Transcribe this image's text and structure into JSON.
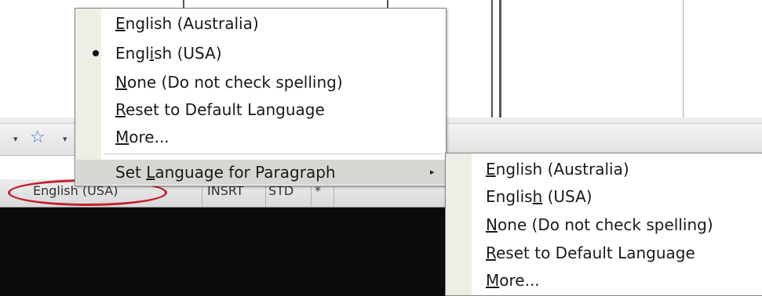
{
  "status_bar": {
    "language": "English (USA)",
    "insert_mode": "INSRT",
    "selection_mode": "STD",
    "modified": "*"
  },
  "language_menu": {
    "items": [
      {
        "label_pre": "",
        "mnemonic": "E",
        "label_post": "nglish (Australia)",
        "checked": false
      },
      {
        "label_pre": "Engl",
        "mnemonic": "i",
        "label_post": "sh (USA)",
        "checked": true
      },
      {
        "label_pre": "",
        "mnemonic": "N",
        "label_post": "one (Do not check spelling)",
        "checked": false
      },
      {
        "label_pre": "",
        "mnemonic": "R",
        "label_post": "eset to Default Language",
        "checked": false
      },
      {
        "label_pre": "",
        "mnemonic": "M",
        "label_post": "ore...",
        "checked": false
      }
    ],
    "submenu_item": {
      "label_pre": "Set ",
      "mnemonic": "L",
      "label_post": "anguage for Paragraph",
      "arrow": "▸",
      "active": true
    }
  },
  "paragraph_submenu": {
    "items": [
      {
        "label_pre": "",
        "mnemonic": "E",
        "label_post": "nglish (Australia)"
      },
      {
        "label_pre": "Englis",
        "mnemonic": "h",
        "label_post": " (USA)"
      },
      {
        "label_pre": "",
        "mnemonic": "N",
        "label_post": "one (Do not check spelling)"
      },
      {
        "label_pre": "",
        "mnemonic": "R",
        "label_post": "eset to Default Language"
      },
      {
        "label_pre": "",
        "mnemonic": "M",
        "label_post": "ore..."
      }
    ]
  },
  "toolbar": {
    "dropdown_glyph": "▾",
    "star_icon": "star-icon",
    "star_glyph": "☆"
  },
  "colors": {
    "highlight": "#c0202d",
    "menu_gutter": "#eeede6",
    "active_item": "#d6d7d2"
  }
}
